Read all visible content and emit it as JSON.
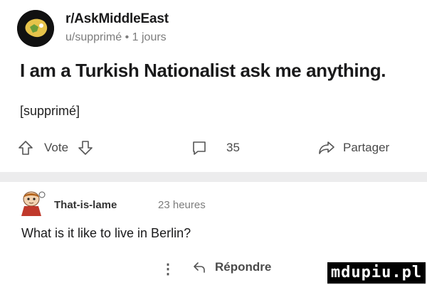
{
  "post": {
    "community": "r/AskMiddleEast",
    "meta": "u/supprimé • 1 jours",
    "title": "I am a Turkish Nationalist ask me anything.",
    "body": "[supprimé]",
    "actions": {
      "vote_label": "Vote",
      "comment_count": "35",
      "share_label": "Partager"
    }
  },
  "comment": {
    "author": "That-is-lame",
    "time": "23 heures",
    "text": "What is it like to live in Berlin?",
    "more_label": "⋮",
    "reply_label": "Répondre"
  },
  "watermark": {
    "text": "mdupiu.pl"
  },
  "colors": {
    "text": "#1a1a1b",
    "muted": "#7c7c7c",
    "divider": "#ececed",
    "watermark_bg": "#000000"
  },
  "icons": [
    "community-avatar",
    "upvote-arrow-icon",
    "downvote-arrow-icon",
    "comment-bubble-icon",
    "share-arrow-icon",
    "user-avatar",
    "more-dots-icon",
    "reply-arrow-icon"
  ]
}
